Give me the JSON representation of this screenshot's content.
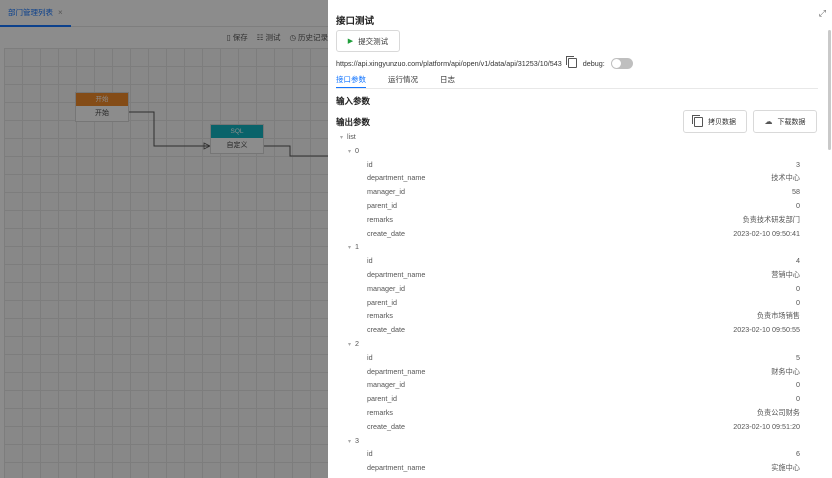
{
  "editor": {
    "tab_label": "部门管理列表",
    "toolbar": {
      "save": "保存",
      "test": "测试",
      "history": "历史记录"
    },
    "nodes": {
      "start": {
        "header": "开始",
        "body": "开始"
      },
      "sql": {
        "header": "SQL",
        "body": "自定义"
      }
    }
  },
  "drawer": {
    "title": "接口测试",
    "submit_label": "提交测试",
    "url": "https://api.xingyunzuo.com/platform/api/open/v1/data/api/31253/10/543",
    "debug_label": "debug:",
    "tabs": [
      "接口参数",
      "运行情况",
      "日志"
    ],
    "input_section": "输入参数",
    "output_section": "输出参数",
    "copy_label": "拷贝数据",
    "download_label": "下载数据",
    "tree_root": "list",
    "records": [
      {
        "index": "0",
        "fields": [
          {
            "k": "id",
            "v": "3"
          },
          {
            "k": "department_name",
            "v": "技术中心"
          },
          {
            "k": "manager_id",
            "v": "58"
          },
          {
            "k": "parent_id",
            "v": "0"
          },
          {
            "k": "remarks",
            "v": "负责技术研发部门"
          },
          {
            "k": "create_date",
            "v": "2023-02-10 09:50:41"
          }
        ]
      },
      {
        "index": "1",
        "fields": [
          {
            "k": "id",
            "v": "4"
          },
          {
            "k": "department_name",
            "v": "营销中心"
          },
          {
            "k": "manager_id",
            "v": "0"
          },
          {
            "k": "parent_id",
            "v": "0"
          },
          {
            "k": "remarks",
            "v": "负责市场销售"
          },
          {
            "k": "create_date",
            "v": "2023-02-10 09:50:55"
          }
        ]
      },
      {
        "index": "2",
        "fields": [
          {
            "k": "id",
            "v": "5"
          },
          {
            "k": "department_name",
            "v": "财务中心"
          },
          {
            "k": "manager_id",
            "v": "0"
          },
          {
            "k": "parent_id",
            "v": "0"
          },
          {
            "k": "remarks",
            "v": "负责公司财务"
          },
          {
            "k": "create_date",
            "v": "2023-02-10 09:51:20"
          }
        ]
      },
      {
        "index": "3",
        "fields": [
          {
            "k": "id",
            "v": "6"
          },
          {
            "k": "department_name",
            "v": "实施中心"
          }
        ]
      }
    ]
  }
}
